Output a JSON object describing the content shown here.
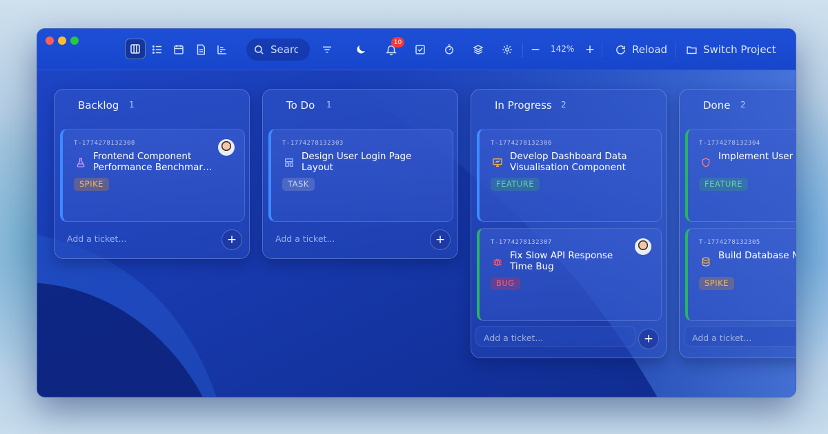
{
  "toolbar": {
    "search_placeholder": "Search",
    "notification_count": "10",
    "zoom_level": "142%",
    "zoom_minus": "−",
    "zoom_plus": "+",
    "reload_label": "Reload",
    "switch_project_label": "Switch Project",
    "icons": [
      "board-view-icon",
      "list-view-icon",
      "calendar-view-icon",
      "document-view-icon",
      "timeline-view-icon",
      "search-icon",
      "filter-icon",
      "moon-icon",
      "bell-icon",
      "checkbox-icon",
      "timer-icon",
      "layers-icon",
      "gear-icon",
      "reload-icon",
      "folder-icon"
    ]
  },
  "add_placeholder": "Add a ticket...",
  "columns": [
    {
      "title": "Backlog",
      "count": "1",
      "cards": [
        {
          "id": "T-1774278132308",
          "title": "Frontend Component Performance Benchmar…",
          "tag": "SPIKE",
          "icon": "flask-icon",
          "has_avatar": true
        }
      ]
    },
    {
      "title": "To Do",
      "count": "1",
      "cards": [
        {
          "id": "T-1774278132303",
          "title": "Design User Login Page Layout",
          "tag": "TASK",
          "icon": "layout-icon",
          "has_avatar": false
        }
      ]
    },
    {
      "title": "In Progress",
      "count": "2",
      "cards": [
        {
          "id": "T-1774278132306",
          "title": "Develop Dashboard Data Visualisation Component",
          "tag": "FEATURE",
          "icon": "monitor-icon",
          "has_avatar": false
        },
        {
          "id": "T-1774278132307",
          "title": "Fix Slow API Response Time Bug",
          "tag": "BUG",
          "icon": "bug-icon",
          "has_avatar": true
        }
      ]
    },
    {
      "title": "Done",
      "count": "2",
      "cards": [
        {
          "id": "T-1774278132304",
          "title": "Implement User Authentication M",
          "tag": "FEATURE",
          "icon": "shield-icon",
          "has_avatar": false
        },
        {
          "id": "T-1774278132305",
          "title": "Build Database Migration Framew",
          "tag": "SPIKE",
          "icon": "database-icon",
          "has_avatar": false
        }
      ]
    }
  ],
  "colors": {
    "accent_blue": "#3d8bff",
    "done_green": "#28b463",
    "spike": "#f0b860",
    "feature": "#62d894",
    "bug": "#ff5f6d",
    "badge_red": "#ef3b3b"
  }
}
